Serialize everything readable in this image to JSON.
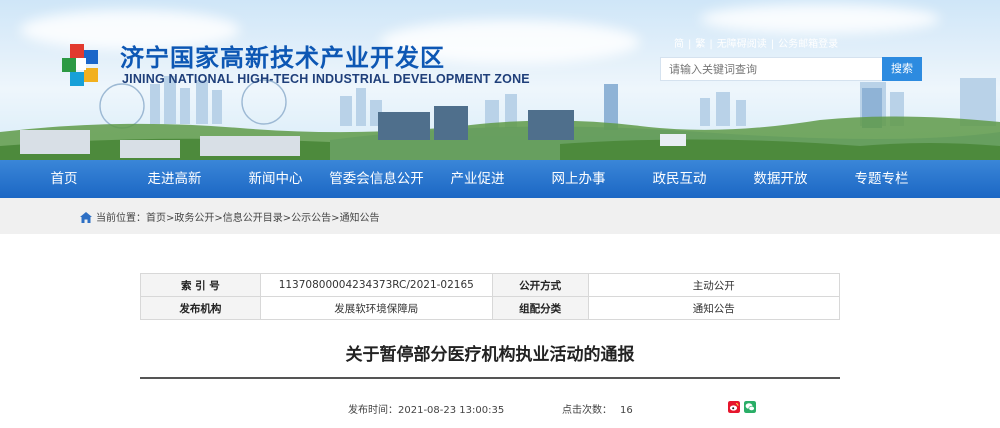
{
  "header": {
    "title": "济宁国家高新技术产业开发区",
    "subtitle": "JINING NATIONAL HIGH-TECH INDUSTRIAL DEVELOPMENT ZONE",
    "top_links": [
      "简",
      "繁",
      "无障碍阅读",
      "公务邮箱登录"
    ],
    "search": {
      "placeholder": "请输入关键词查询",
      "button_label": "搜索"
    }
  },
  "nav": {
    "items": [
      "首页",
      "走进高新",
      "新闻中心",
      "管委会信息公开",
      "产业促进",
      "网上办事",
      "政民互动",
      "数据开放",
      "专题专栏"
    ]
  },
  "breadcrumb": {
    "prefix": "当前位置：",
    "items": [
      "首页",
      "政务公开",
      "信息公开目录",
      "公示公告",
      "通知公告"
    ],
    "separator": ">"
  },
  "info_table": {
    "index_label": "索 引 号",
    "index_value": "11370800004234373RC/2021-02165",
    "open_method_label": "公开方式",
    "open_method_value": "主动公开",
    "publisher_label": "发布机构",
    "publisher_value": "发展软环境保障局",
    "category_label": "组配分类",
    "category_value": "通知公告"
  },
  "article": {
    "title": "关于暂停部分医疗机构执业活动的通报",
    "publish_time_label": "发布时间：",
    "publish_time": "2021-08-23 13:00:35",
    "clicks_label": "点击次数：",
    "clicks": "16"
  },
  "colors": {
    "brand_blue": "#0d57b4",
    "nav_blue": "#1c67c4",
    "search_button": "#2d8be0",
    "weibo_red": "#e6162d",
    "wechat_green": "#2aae67"
  }
}
